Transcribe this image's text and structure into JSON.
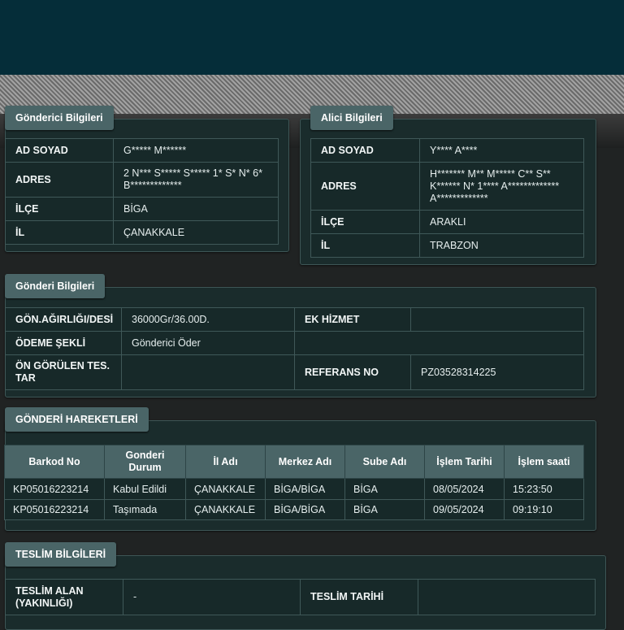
{
  "sender": {
    "title": "Gönderici Bilgileri",
    "rows": [
      {
        "label": "AD SOYAD",
        "value": "G***** M******"
      },
      {
        "label": "ADRES",
        "value": "2 N*** S***** S***** 1* S* N* 6* B*************"
      },
      {
        "label": "İLÇE",
        "value": "BİGA"
      },
      {
        "label": "İL",
        "value": "ÇANAKKALE"
      }
    ]
  },
  "receiver": {
    "title": "Alici Bilgileri",
    "rows": [
      {
        "label": "AD SOYAD",
        "value": "Y**** A****"
      },
      {
        "label": "ADRES",
        "value": "H******* M** M***** C** S** K****** N* 1**** A************* A*************"
      },
      {
        "label": "İLÇE",
        "value": "ARAKLI"
      },
      {
        "label": "İL",
        "value": "TRABZON"
      }
    ]
  },
  "shipment": {
    "title": "Gönderi Bilgileri",
    "weight_label": "GÖN.AĞIRLIĞI/DESİ",
    "weight_value": "36000Gr/36.00D.",
    "extra_service_label": "EK HİZMET",
    "extra_service_value": "",
    "payment_label": "ÖDEME ŞEKLİ",
    "payment_value": "Gönderici Öder",
    "eta_label": "ÖN GÖRÜLEN TES. TAR",
    "eta_value": "",
    "reference_label": "REFERANS NO",
    "reference_value": "PZ03528314225"
  },
  "movements": {
    "title": "GÖNDERİ HAREKETLERİ",
    "columns": [
      "Barkod No",
      "Gonderi Durum",
      "İl Adı",
      "Merkez Adı",
      "Sube Adı",
      "İşlem Tarihi",
      "İşlem saati"
    ],
    "rows": [
      [
        "KP05016223214",
        "Kabul Edildi",
        "ÇANAKKALE",
        "BİGA/BİGA",
        "BİGA",
        "08/05/2024",
        "15:23:50"
      ],
      [
        "KP05016223214",
        "Taşımada",
        "ÇANAKKALE",
        "BİGA/BİGA",
        "BİGA",
        "09/05/2024",
        "09:19:10"
      ]
    ]
  },
  "delivery": {
    "title": "TESLİM BİLGİLERİ",
    "receiver_label": "TESLİM ALAN (YAKINLIĞI)",
    "receiver_value": "-",
    "date_label": "TESLİM TARİHİ",
    "date_value": ""
  },
  "colors": {
    "header": "#052d39",
    "tab": "#4a6567",
    "cell": "#172929"
  }
}
